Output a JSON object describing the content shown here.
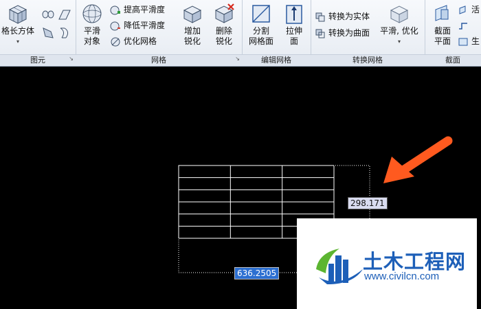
{
  "ribbon": {
    "panels": {
      "primitives": {
        "title": "图元",
        "box_label": "格长方体"
      },
      "mesh": {
        "title": "网格",
        "smooth_object_label": "平滑\n对象",
        "increase_smoothness": "提高平滑度",
        "decrease_smoothness": "降低平滑度",
        "refine_mesh": "优化网格",
        "add_crease_label": "增加\n锐化",
        "remove_crease_label": "删除\n锐化"
      },
      "edit_mesh": {
        "title": "编辑网格",
        "split_face_label": "分割\n网格面",
        "extrude_face_label": "拉伸\n面"
      },
      "convert_mesh": {
        "title": "转换网格",
        "convert_to_solid": "转换为实体",
        "convert_to_surface": "转换为曲面",
        "smooth_optimized": "平滑, 优化"
      },
      "section": {
        "title": "截面",
        "section_plane_label": "截面\n平面",
        "live_section_partial": "活",
        "generate_partial": "生"
      }
    }
  },
  "canvas": {
    "dimensions": {
      "height_value": "298.171",
      "width_value": "636.2505"
    },
    "table_rows": 6,
    "table_cols": 3
  },
  "watermark": {
    "brand_name": "土木工程网",
    "url": "www.civilcn.com"
  },
  "colors": {
    "arrow": "#ff5a1f",
    "brand_blue": "#1d5fb8",
    "brand_green": "#5cb531",
    "dim_highlight_bg": "#d9dcf0",
    "dim_selected_bg": "#2c6fd1"
  }
}
